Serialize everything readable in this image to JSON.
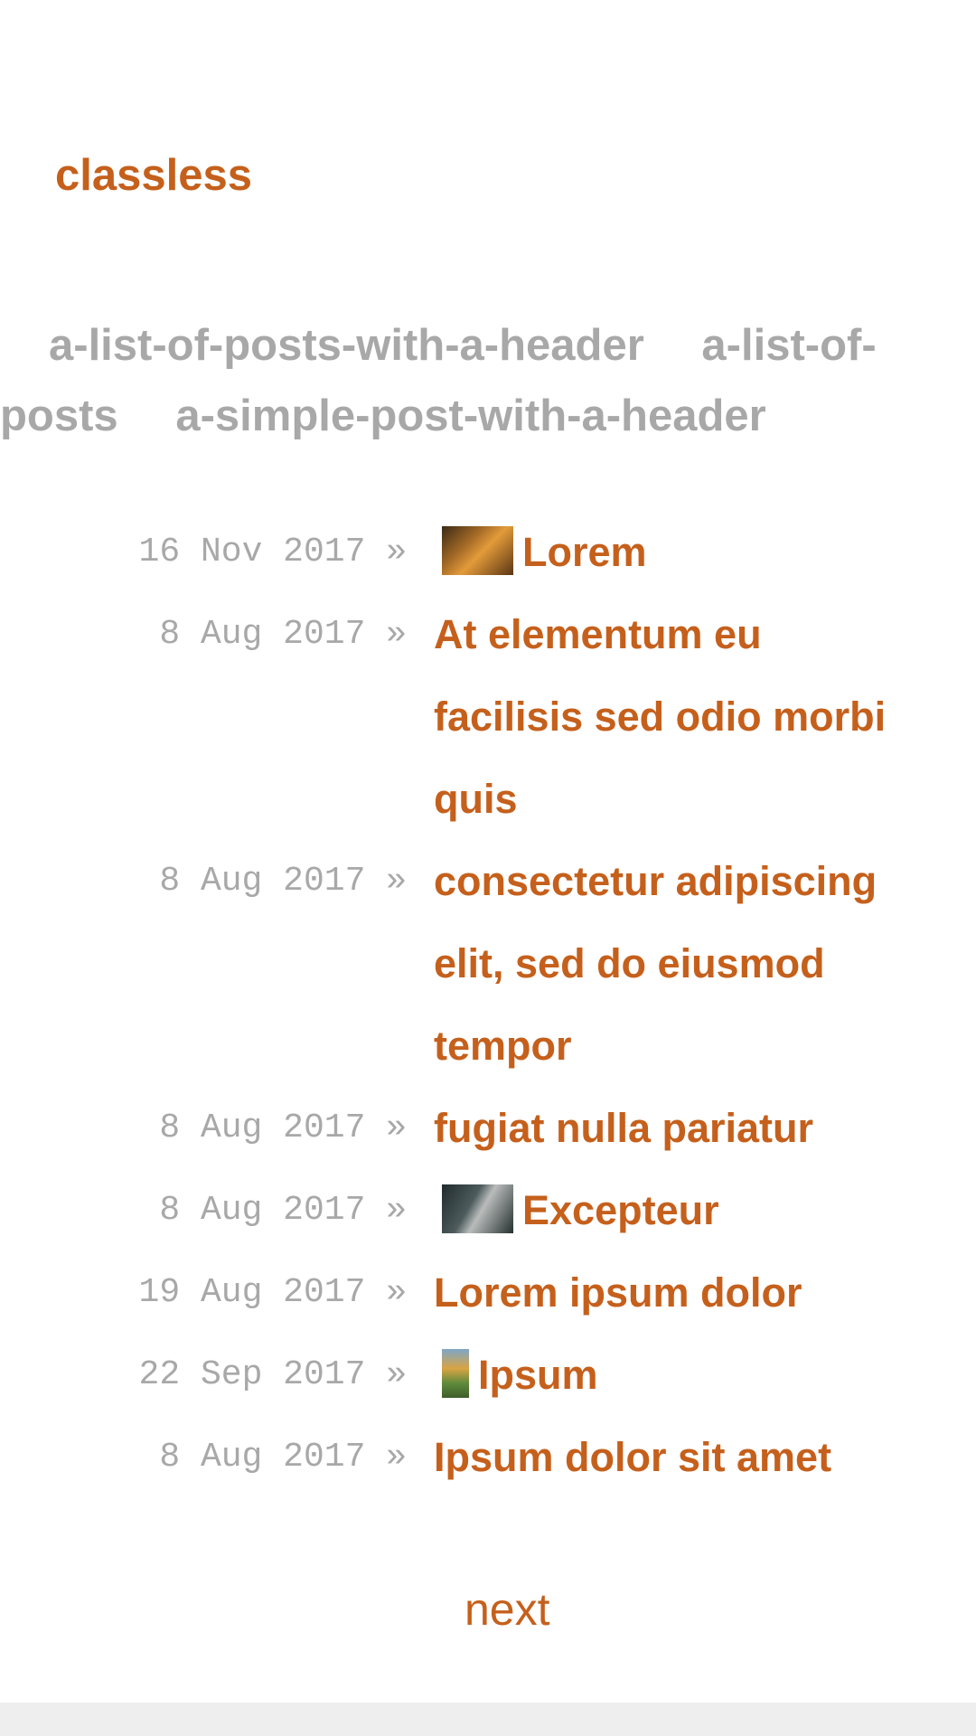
{
  "site": {
    "title": "classless"
  },
  "tags": [
    "a-list-of-posts-with-a-header",
    "a-list-of-posts",
    "a-simple-post-with-a-header"
  ],
  "posts": [
    {
      "date": "16 Nov 2017 »",
      "title": "Lorem",
      "thumbnail": "sunset-photo"
    },
    {
      "date": "8 Aug 2017 »",
      "title": "At elementum eu facilisis sed odio morbi quis"
    },
    {
      "date": "8 Aug 2017 »",
      "title": "consectetur adipiscing elit, sed do eiusmod tempor"
    },
    {
      "date": "8 Aug 2017 »",
      "title": "fugiat nulla pariatur"
    },
    {
      "date": "8 Aug 2017 »",
      "title": "Excepteur",
      "thumbnail": "couple-photo"
    },
    {
      "date": "19 Aug 2017 »",
      "title": "Lorem ipsum dolor"
    },
    {
      "date": "22 Sep 2017 »",
      "title": "Ipsum",
      "thumbnail": "flower-photo"
    },
    {
      "date": "8 Aug 2017 »",
      "title": "Ipsum dolor sit amet"
    }
  ],
  "pagination": {
    "next_label": "next"
  },
  "colors": {
    "accent": "#c5601c",
    "muted": "#a8a8a8",
    "footer": "#eeeeee"
  }
}
